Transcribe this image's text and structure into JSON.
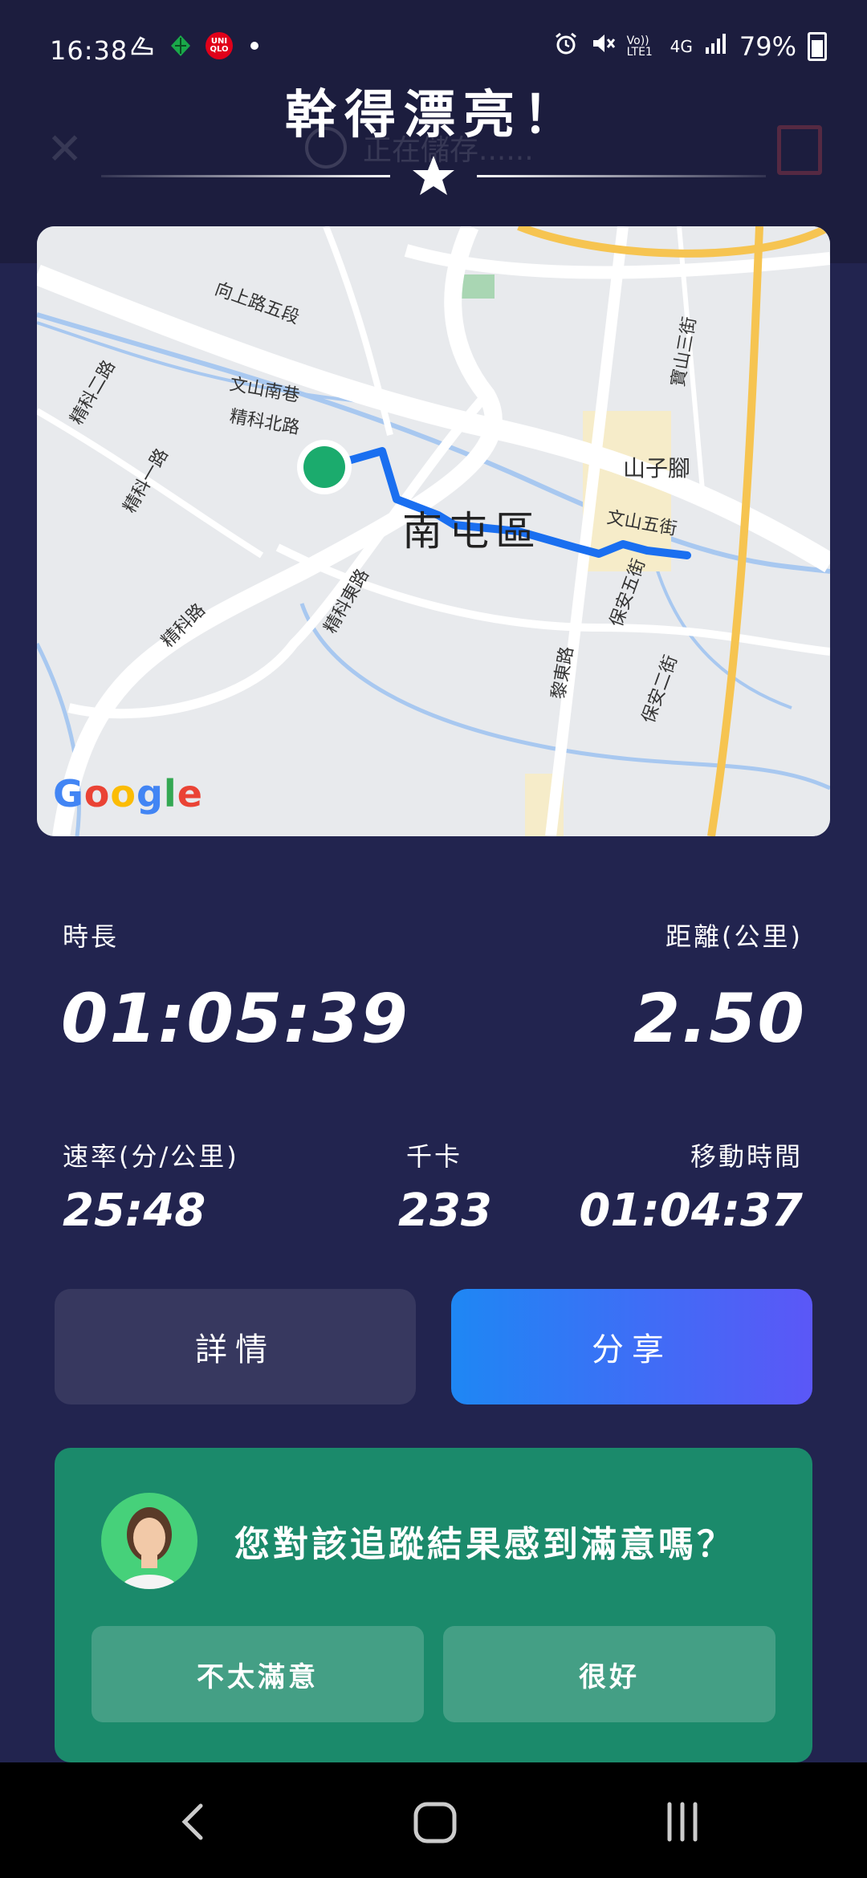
{
  "status_bar": {
    "time": "16:38",
    "network": "4G",
    "volte": "Vo)) LTE1",
    "battery": "79%"
  },
  "header": {
    "behind_status": "正在儲存......",
    "title": "幹得漂亮！"
  },
  "map": {
    "district": "南屯區",
    "labels": [
      "向上路五段",
      "文山南巷",
      "精科北路",
      "精科二路",
      "精科一路",
      "精科路",
      "精科東路",
      "山子腳",
      "文山五街",
      "保安五街",
      "保安二街",
      "黎東路",
      "寶山三街"
    ],
    "attribution": "Google"
  },
  "stats": {
    "duration_label": "時長",
    "duration_value": "01:05:39",
    "distance_label": "距離(公里)",
    "distance_value": "2.50",
    "pace_label": "速率(分/公里)",
    "pace_value": "25:48",
    "kcal_label": "千卡",
    "kcal_value": "233",
    "moving_label": "移動時間",
    "moving_value": "01:04:37"
  },
  "actions": {
    "details": "詳情",
    "share": "分享"
  },
  "feedback": {
    "question": "您對該追蹤結果感到滿意嗎？",
    "option_bad": "不太滿意",
    "option_good": "很好"
  }
}
